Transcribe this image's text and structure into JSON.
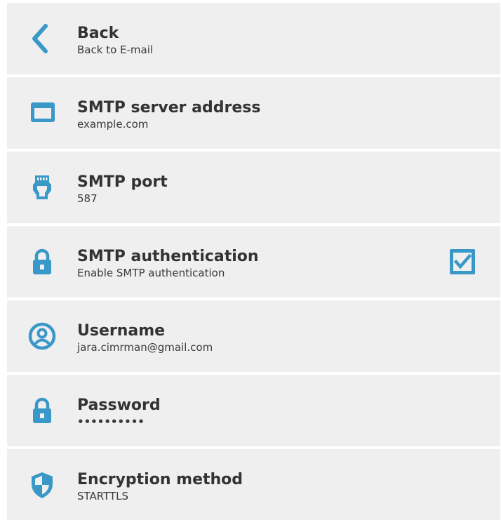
{
  "colors": {
    "accent": "#3a98c8",
    "row_background": "#efefef",
    "text": "#333333"
  },
  "items": [
    {
      "icon": "chevron-left-icon",
      "title": "Back",
      "subtitle": "Back to E-mail"
    },
    {
      "icon": "window-icon",
      "title": "SMTP server address",
      "subtitle": "example.com"
    },
    {
      "icon": "network-plug-icon",
      "title": "SMTP port",
      "subtitle": "587"
    },
    {
      "icon": "lock-icon",
      "title": "SMTP authentication",
      "subtitle": "Enable SMTP authentication",
      "checked": true
    },
    {
      "icon": "user-circle-icon",
      "title": "Username",
      "subtitle": "jara.cimrman@gmail.com"
    },
    {
      "icon": "lock-icon",
      "title": "Password",
      "subtitle": "••••••••••"
    },
    {
      "icon": "shield-icon",
      "title": "Encryption method",
      "subtitle": "STARTTLS"
    }
  ]
}
